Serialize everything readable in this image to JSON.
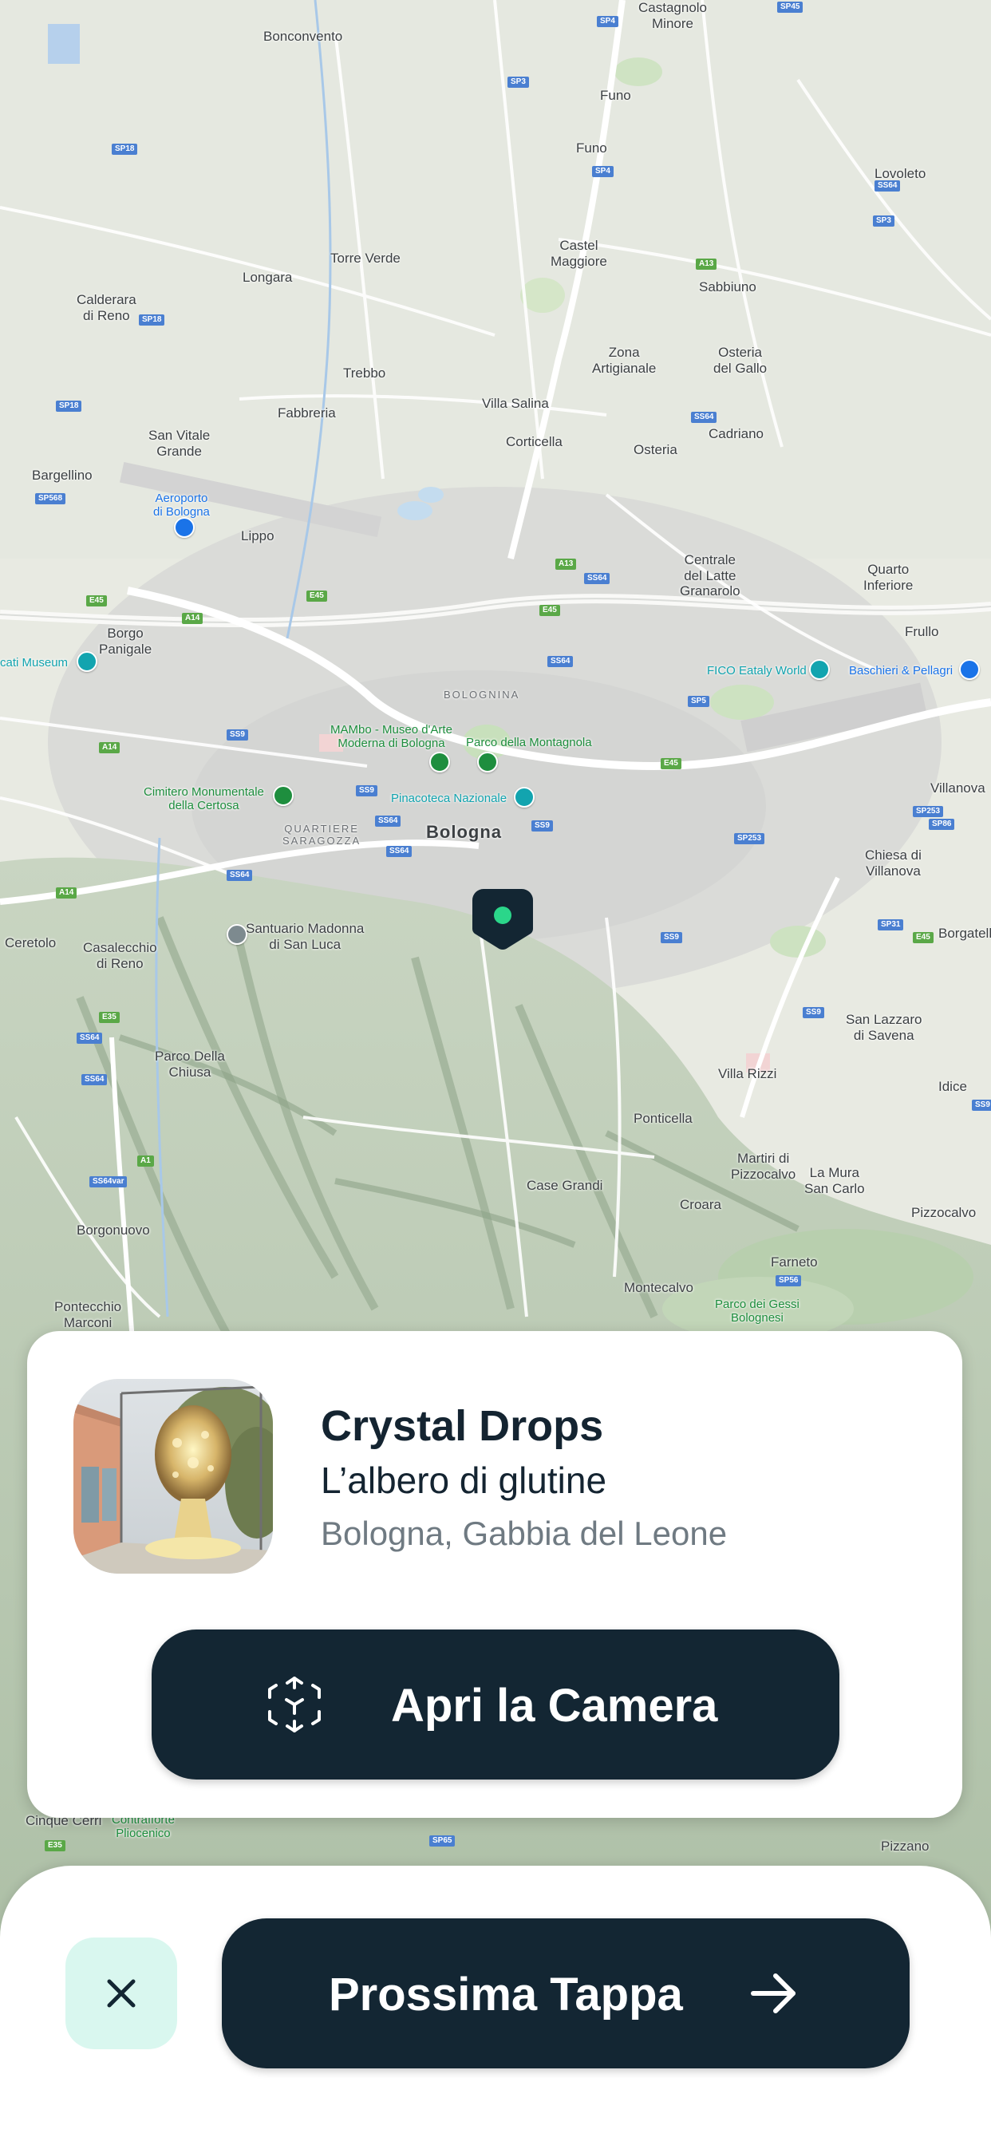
{
  "map": {
    "marker_color": "#2bd68a",
    "labels": {
      "castagnolo": "Castagnolo\nMinore",
      "bonconvento": "Bonconvento",
      "funo1": "Funo",
      "funo2": "Funo",
      "lovoleto": "Lovoleto",
      "castel_maggiore": "Castel\nMaggiore",
      "sabbiuno": "Sabbiuno",
      "torre_verde": "Torre Verde",
      "longara": "Longara",
      "calderara": "Calderara\ndi Reno",
      "trebbo": "Trebbo",
      "zona_artigianale": "Zona\nArtigianale",
      "osteria_del_gallo": "Osteria\ndel Gallo",
      "fabbreria": "Fabbreria",
      "villa_salina": "Villa Salina",
      "san_vitale": "San Vitale\nGrande",
      "corticella": "Corticella",
      "cadriano": "Cadriano",
      "osteria": "Osteria",
      "bargellino": "Bargellino",
      "aeroporto": "Aeroporto\ndi Bologna",
      "lippo": "Lippo",
      "centrale_granarolo": "Centrale\ndel Latte\nGranarolo",
      "quarto_inferiore": "Quarto\nInferiore",
      "borgo_panigale": "Borgo\nPanigale",
      "frullo": "Frullo",
      "ducati_museum": "cati Museum",
      "fico": "FICO Eataly World",
      "baschieri": "Baschieri & Pellagri",
      "bolognina": "BOLOGNINA",
      "mambo": "MAMbo - Museo d'Arte\nModerna di Bologna",
      "parco_montagnola": "Parco della Montagnola",
      "cimitero": "Cimitero Monumentale\ndella Certosa",
      "pinacoteca": "Pinacoteca Nazionale",
      "villanova": "Villanova",
      "quartiere_saragozza": "QUARTIERE\nSARAGOZZA",
      "bologna": "Bologna",
      "chiesa_villanova": "Chiesa di\nVillanova",
      "santuario": "Santuario Madonna\ndi San Luca",
      "casalecchio": "Casalecchio\ndi Reno",
      "ceretolo": "Ceretolo",
      "borgatella": "Borgatella",
      "san_lazzaro": "San Lazzaro\ndi Savena",
      "parco_chiusa": "Parco Della\nChiusa",
      "villa_rizzi": "Villa Rizzi",
      "idice": "Idice",
      "ponticella": "Ponticella",
      "martiri": "Martiri di\nPizzocalvo",
      "la_mura": "La Mura\nSan Carlo",
      "case_grandi": "Case Grandi",
      "croara": "Croara",
      "pizzocalvo": "Pizzocalvo",
      "borgonuovo": "Borgonuovo",
      "farneto": "Farneto",
      "pontecchio": "Pontecchio\nMarconi",
      "montecalvo": "Montecalvo",
      "parco_gessi": "Parco dei Gessi\nBolognesi",
      "cinque_cerri": "Cinque Cerri",
      "contrafforte": "Contrafforte\nPliocenico",
      "pizzano": "Pizzano"
    }
  },
  "artwork": {
    "title": "Crystal Drops",
    "subtitle": "L’albero di glutine",
    "location": "Bologna, Gabbia del Leone"
  },
  "actions": {
    "open_camera_label": "Apri la Camera",
    "next_stop_label": "Prossima Tappa"
  },
  "colors": {
    "primary_dark": "#132633",
    "close_bg": "#d9f7ef",
    "text_secondary": "#6f7a82"
  },
  "icons": {
    "ar": "ar-cube-icon",
    "close": "close-icon",
    "arrow": "arrow-right-icon"
  }
}
